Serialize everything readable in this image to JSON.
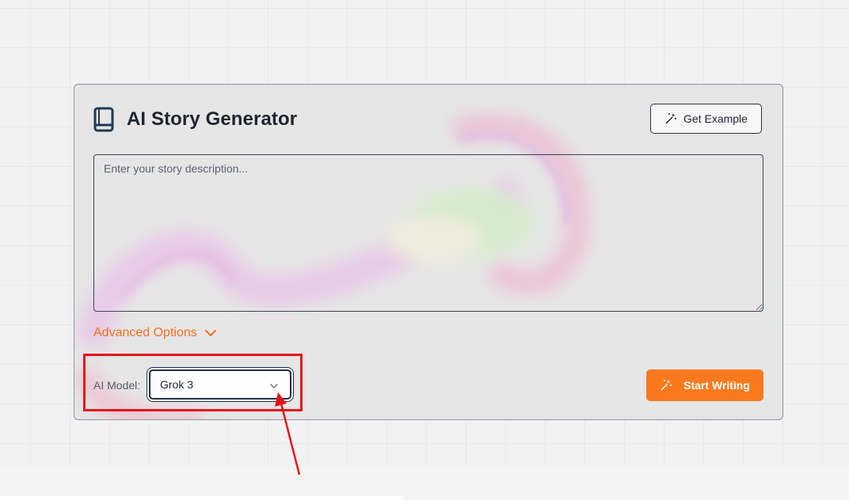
{
  "card": {
    "title": "AI Story Generator",
    "title_icon": "book-icon",
    "example_button": {
      "label": "Get Example",
      "icon": "magic-wand-icon"
    },
    "story_input": {
      "placeholder": "Enter your story description...",
      "value": ""
    },
    "advanced": {
      "label": "Advanced Options",
      "icon": "chevron-down-icon"
    },
    "model": {
      "label": "AI Model:",
      "selected": "Grok 3"
    },
    "start_button": {
      "label": "Start Writing",
      "icon": "magic-wand-icon"
    }
  },
  "colors": {
    "accent": "#f97a1e",
    "accent_text": "#f36f1e",
    "annotation": "#e8101a",
    "border": "#1f3048"
  }
}
